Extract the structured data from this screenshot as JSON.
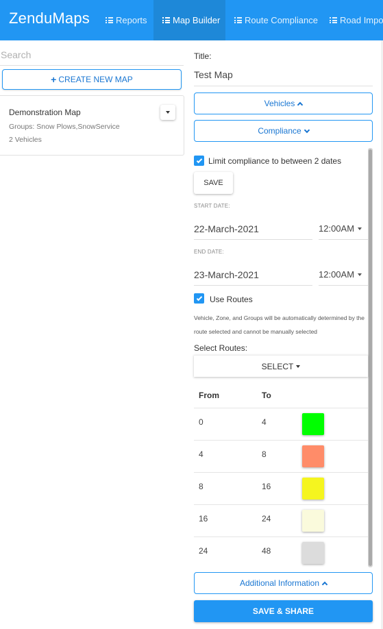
{
  "navbar": {
    "brand": "ZenduMaps",
    "tabs": [
      {
        "label": "Reports",
        "icon": "list-icon"
      },
      {
        "label": "Map Builder",
        "icon": "list-icon",
        "active": true
      },
      {
        "label": "Route Compliance",
        "icon": "list-icon"
      },
      {
        "label": "Road Import",
        "icon": "list-icon"
      }
    ]
  },
  "sidebar": {
    "search_placeholder": "Search",
    "create_label": "CREATE NEW MAP",
    "maps": [
      {
        "name": "Demonstration Map",
        "groups": "Groups: Snow Plows,SnowService",
        "vehicles": "2 Vehicles"
      }
    ]
  },
  "editor": {
    "title_label": "Title:",
    "title_value": "Test Map",
    "vehicles_label": "Vehicles",
    "compliance_label": "Compliance",
    "limit_label": "Limit compliance to between 2 dates",
    "save_label": "SAVE",
    "start_date_label": "START DATE:",
    "start_date": "22-March-2021",
    "start_time": "12:00AM",
    "end_date_label": "END DATE:",
    "end_date": "23-March-2021",
    "end_time": "12:00AM",
    "use_routes_label": "Use Routes",
    "help_text": "Vehicle, Zone, and Groups will be automatically determined by the route selected and cannot be manually selected",
    "select_routes_label": "Select Routes:",
    "select_label": "SELECT",
    "table": {
      "headers": [
        "From",
        "To"
      ],
      "rows": [
        {
          "from": "0",
          "to": "4",
          "color": "#00ff00"
        },
        {
          "from": "4",
          "to": "8",
          "color": "#ff8c69"
        },
        {
          "from": "8",
          "to": "16",
          "color": "#f5f51f"
        },
        {
          "from": "16",
          "to": "24",
          "color": "#fafadc"
        },
        {
          "from": "24",
          "to": "48",
          "color": "#dcdcdc"
        }
      ]
    },
    "additional_label": "Additional Information",
    "save_share_label": "SAVE & SHARE"
  },
  "colors": {
    "accent": "#2196f3",
    "nav_active": "#1e88d8"
  }
}
